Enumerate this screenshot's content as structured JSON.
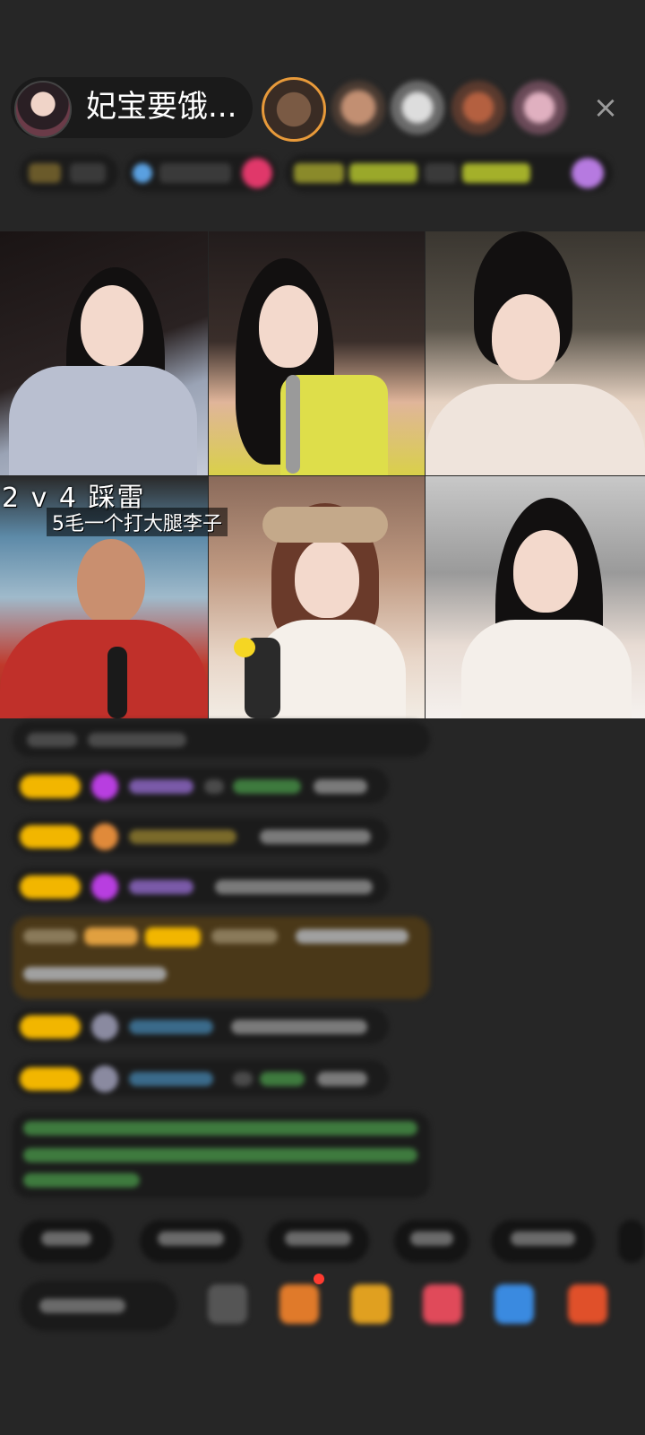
{
  "header": {
    "host_name": "妃宝要饿...",
    "close_label": "×",
    "viewers": [
      "viewer-1",
      "viewer-2",
      "viewer-3",
      "viewer-4",
      "viewer-5"
    ]
  },
  "video_grid": {
    "pk_label": "2 v 4  踩雷",
    "pk_subtitle": "5毛一个打大腿李子"
  },
  "colors": {
    "background": "#262626",
    "level_badge": "#f2b600",
    "gift_message_bg": "#4a3818",
    "accent_orange": "#e89a3a"
  },
  "icons": {
    "close": "close-icon",
    "gem": "diamond-icon"
  }
}
